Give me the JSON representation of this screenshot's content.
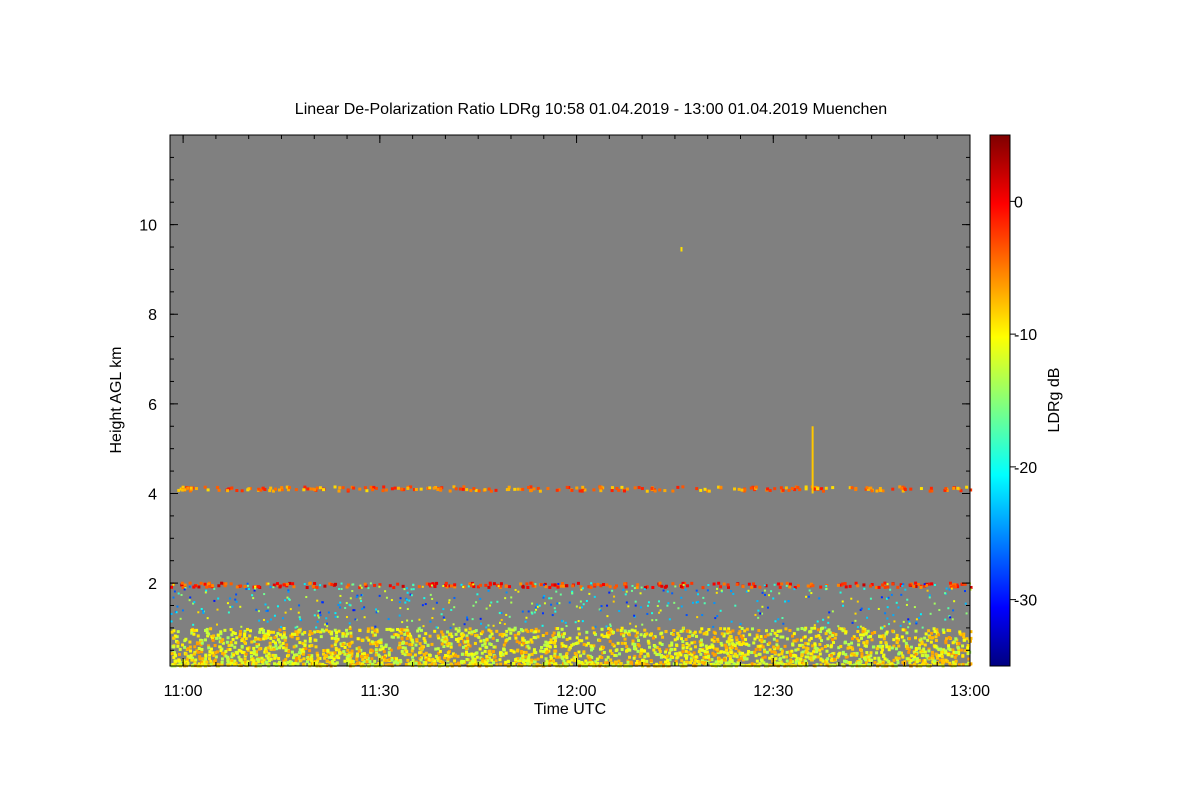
{
  "chart_data": {
    "type": "heatmap",
    "title": "Linear De-Polarization Ratio LDRg   10:58 01.04.2019 - 13:00 01.04.2019 Muenchen",
    "xlabel": "Time UTC",
    "ylabel": "Height AGL km",
    "xlim": [
      "10:58",
      "13:00"
    ],
    "ylim_km": [
      0.15,
      12
    ],
    "x_ticks": [
      "11:00",
      "11:30",
      "12:00",
      "12:30",
      "13:00"
    ],
    "y_ticks": [
      "2",
      "4",
      "6",
      "8",
      "10"
    ],
    "background_value": "no signal (gray)",
    "colorbar": {
      "label": "LDRg dB",
      "range": [
        -35,
        5
      ],
      "ticks": [
        "0",
        "-10",
        "-20",
        "-30"
      ],
      "colormap": "jet"
    },
    "features": [
      {
        "name": "boundary-layer aerosol",
        "height_km": [
          0.15,
          1.0
        ],
        "ldr_db": -10
      },
      {
        "name": "depolarizing layer near 2 km",
        "height_km": [
          1.9,
          2.0
        ],
        "ldr_db": -2
      },
      {
        "name": "layer near 4.1 km",
        "height_km": [
          4.05,
          4.15
        ],
        "ldr_db": -5
      },
      {
        "name": "vertical streak at 12:36",
        "time": "12:36",
        "height_km": [
          4.0,
          5.5
        ],
        "ldr_db": -8
      },
      {
        "name": "isolated pixel near 9.4 km",
        "time": "12:16",
        "height_km": [
          9.4,
          9.5
        ],
        "ldr_db": -9
      }
    ]
  },
  "colors": {
    "no_data_gray": "#808080",
    "axis": "#000000",
    "background": "#ffffff"
  }
}
